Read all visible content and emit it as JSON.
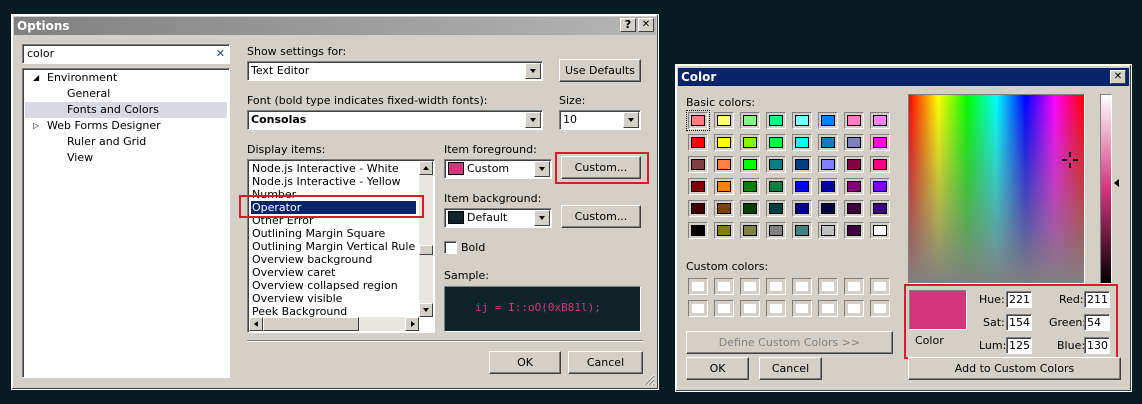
{
  "options": {
    "title": "Options",
    "help_btn": "?",
    "close_btn": "✕",
    "search_value": "color",
    "search_clear": "✕",
    "tree": [
      {
        "label": "Environment",
        "expander": "◢"
      },
      {
        "label": "General"
      },
      {
        "label": "Fonts and Colors",
        "selected": true
      },
      {
        "label": "Web Forms Designer",
        "expander": "▷"
      },
      {
        "label": "Ruler and Grid"
      },
      {
        "label": "View"
      }
    ],
    "show_settings_label": "Show settings for:",
    "show_settings_value": "Text Editor",
    "use_defaults": "Use Defaults",
    "font_label": "Font (bold type indicates fixed-width fonts):",
    "font_value": "Consolas",
    "size_label": "Size:",
    "size_value": "10",
    "display_items_label": "Display items:",
    "display_items": [
      "Node.js Interactive - White",
      "Node.js Interactive - Yellow",
      "Number",
      "Operator",
      "Other Error",
      "Outlining Margin Square",
      "Outlining Margin Vertical Rule",
      "Overview background",
      "Overview caret",
      "Overview collapsed region",
      "Overview visible",
      "Peek Background"
    ],
    "selected_display_item": "Operator",
    "item_fg_label": "Item foreground:",
    "item_fg_value": "Custom",
    "item_fg_color": "#d3367b",
    "custom_btn_fg": "Custom...",
    "item_bg_label": "Item background:",
    "item_bg_value": "Default",
    "item_bg_color": "#0e2429",
    "custom_btn_bg": "Custom...",
    "bold_label": "Bold",
    "sample_label": "Sample:",
    "sample_text": "ij = I::oO(0xB81l);",
    "ok": "OK",
    "cancel": "Cancel"
  },
  "color_dialog": {
    "title": "Color",
    "close_btn": "✕",
    "basic_colors_label": "Basic colors:",
    "basic_colors": [
      "#ff8080",
      "#ffff80",
      "#80ff80",
      "#00ff80",
      "#80ffff",
      "#0080ff",
      "#ff80c0",
      "#ff80ff",
      "#ff0000",
      "#ffff00",
      "#80ff00",
      "#00ff40",
      "#00ffff",
      "#0080c0",
      "#8080c0",
      "#ff00ff",
      "#804040",
      "#ff8040",
      "#00ff00",
      "#008080",
      "#004080",
      "#8080ff",
      "#800040",
      "#ff0080",
      "#800000",
      "#ff8000",
      "#008000",
      "#008040",
      "#0000ff",
      "#0000a0",
      "#800080",
      "#8000ff",
      "#400000",
      "#804000",
      "#004000",
      "#004040",
      "#000080",
      "#000040",
      "#400040",
      "#400080",
      "#000000",
      "#808000",
      "#808040",
      "#808080",
      "#408080",
      "#c0c0c0",
      "#400040",
      "#ffffff"
    ],
    "custom_colors_label": "Custom colors:",
    "define_custom": "Define Custom Colors >>",
    "ok": "OK",
    "cancel": "Cancel",
    "color_solid_label": "Color",
    "color_solid_value": "#d3367b",
    "hue_label": "Hue:",
    "hue": "221",
    "sat_label": "Sat:",
    "sat": "154",
    "lum_label": "Lum:",
    "lum": "125",
    "red_label": "Red:",
    "red": "211",
    "green_label": "Green:",
    "green": "54",
    "blue_label": "Blue:",
    "blue": "130",
    "add_custom": "Add to Custom Colors"
  }
}
